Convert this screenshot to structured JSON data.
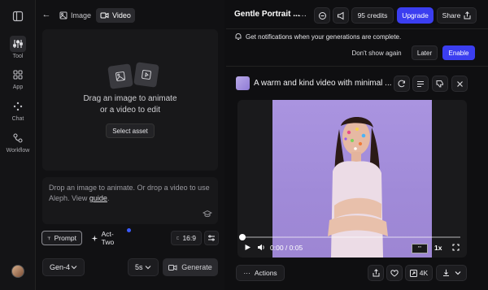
{
  "rail": {
    "items": [
      {
        "label": "Tool",
        "icon": "sliders-icon"
      },
      {
        "label": "App",
        "icon": "grid-icon"
      },
      {
        "label": "Chat",
        "icon": "sparkle-icon"
      },
      {
        "label": "Workflow",
        "icon": "workflow-icon"
      }
    ]
  },
  "left": {
    "tabs": {
      "image": "Image",
      "video": "Video"
    },
    "drop_line1": "Drag an image to animate",
    "drop_line2": "or a video to edit",
    "select_asset": "Select asset",
    "prompt_text": "Drop an image to animate. Or drop a video to use Aleph. View",
    "prompt_link": "guide",
    "prompt_end": ".",
    "chips": {
      "prompt": "Prompt",
      "act_two": "Act-Two",
      "ratio": "16:9"
    },
    "model": "Gen-4",
    "duration": "5s",
    "generate": "Generate"
  },
  "right": {
    "title": "Gentle Portrait ...",
    "credits": "95 credits",
    "upgrade": "Upgrade",
    "share": "Share",
    "notification": "Get notifications when your generations are complete.",
    "dont_show": "Don't show again",
    "later": "Later",
    "enable": "Enable",
    "gen_title": "A warm and kind video with minimal ...",
    "time": "0:00 / 0:05",
    "speed": "1x",
    "actions": "Actions",
    "res": "4K"
  },
  "colors": {
    "accent": "#3b3ef0",
    "bg": "#0f0f11"
  }
}
